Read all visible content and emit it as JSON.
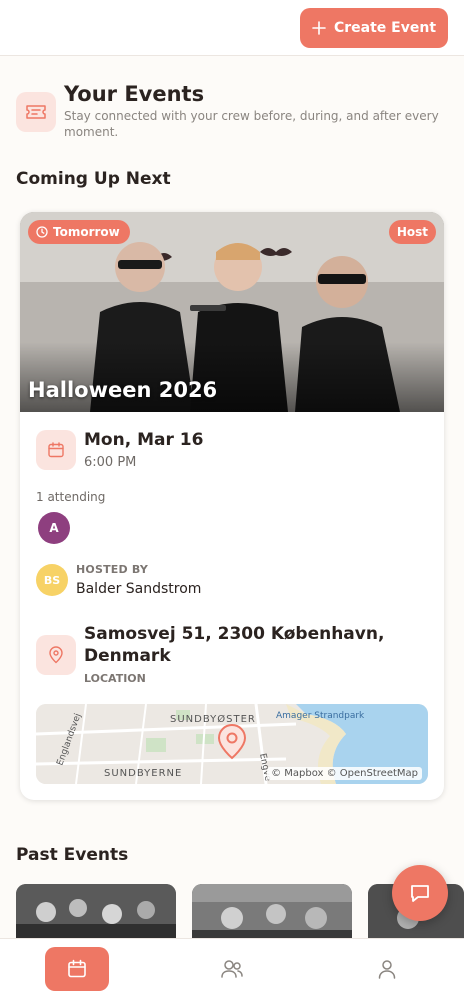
{
  "topbar": {
    "create_label": "Create Event",
    "create_icon": "plus-icon"
  },
  "header": {
    "title": "Your Events",
    "subtitle": "Stay connected with your crew before, during, and after every moment.",
    "icon": "ticket-icon"
  },
  "coming_up": {
    "section_title": "Coming Up Next",
    "event": {
      "badge": "Tomorrow",
      "role_badge": "Host",
      "title": "Halloween 2026",
      "date": "Mon, Mar 16",
      "time": "6:00 PM",
      "attending_text": "1 attending",
      "attendee_initial": "A",
      "host_initials": "BS",
      "hosted_by_label": "HOSTED BY",
      "host_name": "Balder Sandstrom",
      "location": "Samosvej 51, 2300 København, Denmark",
      "location_label": "LOCATION",
      "map": {
        "label_1": "SUNDBYØSTER",
        "label_2": "Amager Strandpark",
        "label_3": "SUNDBYERNE",
        "label_4": "Englandsvej",
        "label_5": "Engve",
        "attribution": "© Mapbox © OpenStreetMap"
      }
    }
  },
  "past": {
    "section_title": "Past Events"
  },
  "nav": {
    "items": [
      {
        "icon": "calendar-icon",
        "active": true
      },
      {
        "icon": "users-icon",
        "active": false
      },
      {
        "icon": "user-icon",
        "active": false
      }
    ]
  },
  "colors": {
    "accent": "#ee7764",
    "accent_soft": "#fbe4df",
    "text": "#2b2320",
    "muted": "#8a8580"
  }
}
